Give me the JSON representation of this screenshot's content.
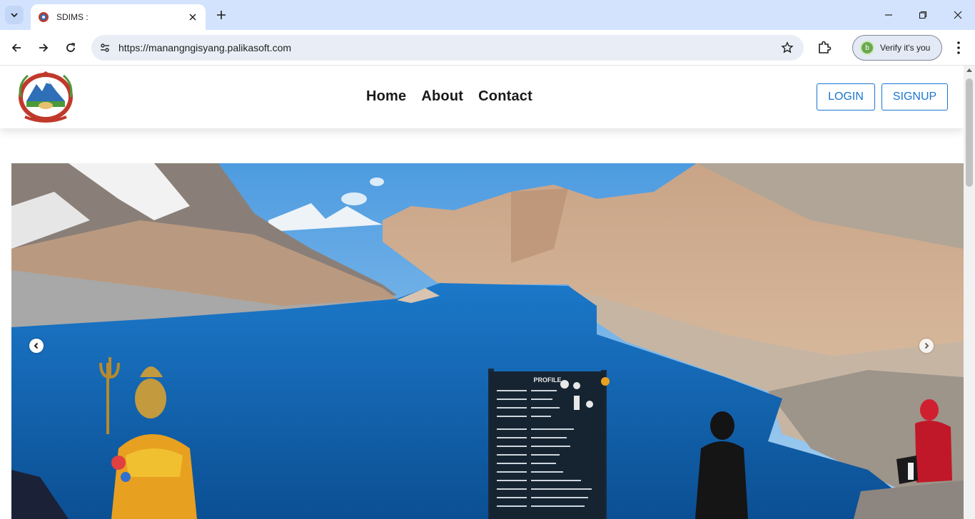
{
  "browser": {
    "tab_title": "SDIMS :",
    "url": "https://manangngisyang.palikasoft.com",
    "profile_button": "Verify it's you",
    "profile_initial": "b"
  },
  "site": {
    "nav": [
      "Home",
      "About",
      "Contact"
    ],
    "login_label": "LOGIN",
    "signup_label": "SIGNUP"
  },
  "carousel": {
    "prev_icon": "chevron-left-icon",
    "next_icon": "chevron-right-icon",
    "sign_heading": "PROFILE"
  },
  "colors": {
    "accent": "#1976d2",
    "chrome_tabstrip": "#d3e3fd",
    "lake": "#0f5fa8"
  }
}
